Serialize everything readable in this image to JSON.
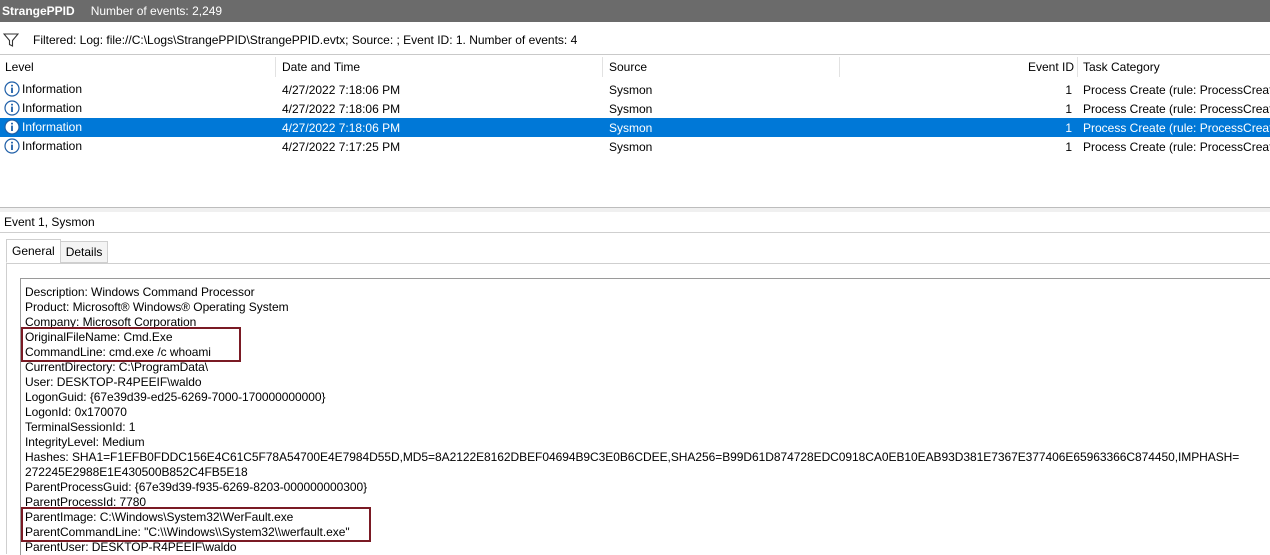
{
  "window": {
    "title": "StrangePPID",
    "event_count": "Number of events: 2,249"
  },
  "filter": {
    "icon": "funnel-icon",
    "text": "Filtered: Log: file://C:\\Logs\\StrangePPID\\StrangePPID.evtx; Source: ; Event ID: 1. Number of events: 4"
  },
  "columns": {
    "level": "Level",
    "date": "Date and Time",
    "source": "Source",
    "event_id": "Event ID",
    "task": "Task Category"
  },
  "events": [
    {
      "level": "Information",
      "date": "4/27/2022 7:18:06 PM",
      "source": "Sysmon",
      "event_id": "1",
      "task": "Process Create (rule: ProcessCreate)",
      "selected": false
    },
    {
      "level": "Information",
      "date": "4/27/2022 7:18:06 PM",
      "source": "Sysmon",
      "event_id": "1",
      "task": "Process Create (rule: ProcessCreate)",
      "selected": false
    },
    {
      "level": "Information",
      "date": "4/27/2022 7:18:06 PM",
      "source": "Sysmon",
      "event_id": "1",
      "task": "Process Create (rule: ProcessCreate)",
      "selected": true
    },
    {
      "level": "Information",
      "date": "4/27/2022 7:17:25 PM",
      "source": "Sysmon",
      "event_id": "1",
      "task": "Process Create (rule: ProcessCreate)",
      "selected": false
    }
  ],
  "detail": {
    "header": "Event 1, Sysmon",
    "tabs": [
      "General",
      "Details"
    ],
    "active_tab": "General",
    "lines": [
      "Description: Windows Command Processor",
      "Product: Microsoft® Windows® Operating System",
      "Company: Microsoft Corporation",
      "OriginalFileName: Cmd.Exe",
      "CommandLine: cmd.exe /c whoami",
      "CurrentDirectory: C:\\ProgramData\\",
      "User: DESKTOP-R4PEEIF\\waldo",
      "LogonGuid: {67e39d39-ed25-6269-7000-170000000000}",
      "LogonId: 0x170070",
      "TerminalSessionId: 1",
      "IntegrityLevel: Medium",
      "Hashes: SHA1=F1EFB0FDDC156E4C61C5F78A54700E4E7984D55D,MD5=8A2122E8162DBEF04694B9C3E0B6CDEE,SHA256=B99D61D874728EDC0918CA0EB10EAB93D381E7367E377406E65963366C874450,IMPHASH=",
      "272245E2988E1E430500B852C4FB5E18",
      "ParentProcessGuid: {67e39d39-f935-6269-8203-000000000300}",
      "ParentProcessId: 7780",
      "ParentImage: C:\\Windows\\System32\\WerFault.exe",
      "ParentCommandLine: \"C:\\\\Windows\\\\System32\\\\werfault.exe\"",
      "ParentUser: DESKTOP-R4PEEIF\\waldo"
    ]
  },
  "colors": {
    "titlebar": "#6b6b6b",
    "selection": "#0078d7",
    "highlight_box": "#7a1a24",
    "info_icon": "#1f5fa8"
  }
}
